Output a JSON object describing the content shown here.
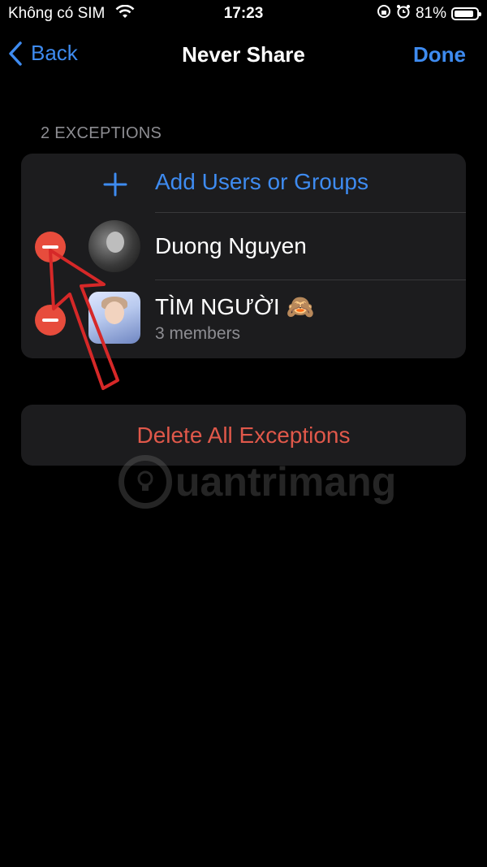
{
  "status_bar": {
    "carrier": "Không có SIM",
    "time": "17:23",
    "battery": "81%",
    "battery_level": 0.81
  },
  "nav": {
    "back_label": "Back",
    "title": "Never Share",
    "done_label": "Done"
  },
  "section_header": "2 EXCEPTIONS",
  "add_label": "Add Users or Groups",
  "exceptions": [
    {
      "name": "Duong Nguyen"
    },
    {
      "name": "TÌM NGƯỜI 🙈",
      "subtitle": "3 members"
    }
  ],
  "delete_all_label": "Delete All Exceptions",
  "watermark": "uantrimang",
  "colors": {
    "accent": "#3e8bf0",
    "destructive": "#e74c3c",
    "annotation_arrow": "#d62828"
  }
}
